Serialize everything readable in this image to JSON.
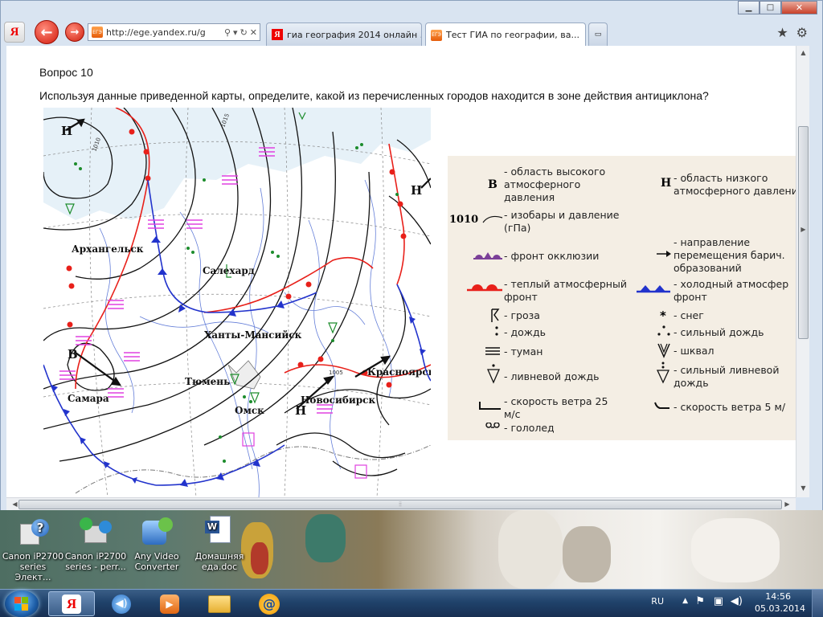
{
  "browser": {
    "url": "http://ege.yandex.ru/g",
    "tabs": [
      {
        "label": "гиа география 2014 онлайн ..."
      },
      {
        "label": "Тест ГИА по географии, ва..."
      }
    ],
    "favicon_label": "ЕГЭ"
  },
  "question": {
    "title": "Вопрос 10",
    "text": "Используя данные приведенной карты, определите, какой из перечисленных городов находится в зоне действия антициклона?"
  },
  "map": {
    "cities": [
      "Архангельск",
      "Салехард",
      "Ханты-Мансийск",
      "Тюмень",
      "Самара",
      "Омск",
      "Новосибирск",
      "Красноярск"
    ],
    "pressure_letters": [
      "Н",
      "Н",
      "В",
      "Н"
    ],
    "isobar_labels": [
      "1010",
      "1015",
      "1005"
    ]
  },
  "legend": {
    "high_symbol": "В",
    "high_label": "- область высокого атмосферного давления",
    "high_lines": [
      "- область высокого",
      "атмосферного",
      "давления"
    ],
    "low_symbol": "Н",
    "low_lines": [
      "- область низкого",
      "атмосферного давлени"
    ],
    "isobar_value": "1010",
    "isobar_lines": [
      "- изобары и давление",
      "(гПа)"
    ],
    "direction_lines": [
      "- направление",
      "перемещения барич.",
      "образований"
    ],
    "occlusion": "- фронт окклюзии",
    "warm_lines": [
      "- теплый атмосферный",
      "фронт"
    ],
    "cold_lines": [
      "- холодный атмосфер",
      "фронт"
    ],
    "thunder": "- гроза",
    "snow": "- снег",
    "rain": "- дождь",
    "heavy_rain": "- сильный дождь",
    "fog": "- туман",
    "squall": "- шквал",
    "shower": "- ливневой дождь",
    "heavy_shower_lines": [
      "- сильный ливневой",
      "дождь"
    ],
    "wind25_lines": [
      "- скорость ветра 25",
      "м/с"
    ],
    "wind5": "- скорость ветра 5 м/",
    "ice": "- гололед"
  },
  "desktop": {
    "icons": [
      {
        "line1": "Canon iP2700",
        "line2": "series Элект..."
      },
      {
        "line1": "Canon iP2700",
        "line2": "series - perr..."
      },
      {
        "line1": "Any Video",
        "line2": "Converter"
      },
      {
        "line1": "Домашняя",
        "line2": "еда.doc"
      }
    ]
  },
  "taskbar": {
    "lang": "RU",
    "time": "14:56",
    "date": "05.03.2014"
  },
  "colors": {
    "warm_front": "#e8201a",
    "cold_front": "#2233cc",
    "occlusion": "#7b3f98",
    "fog": "#e040e0",
    "legend_bg": "#f4eee4"
  }
}
